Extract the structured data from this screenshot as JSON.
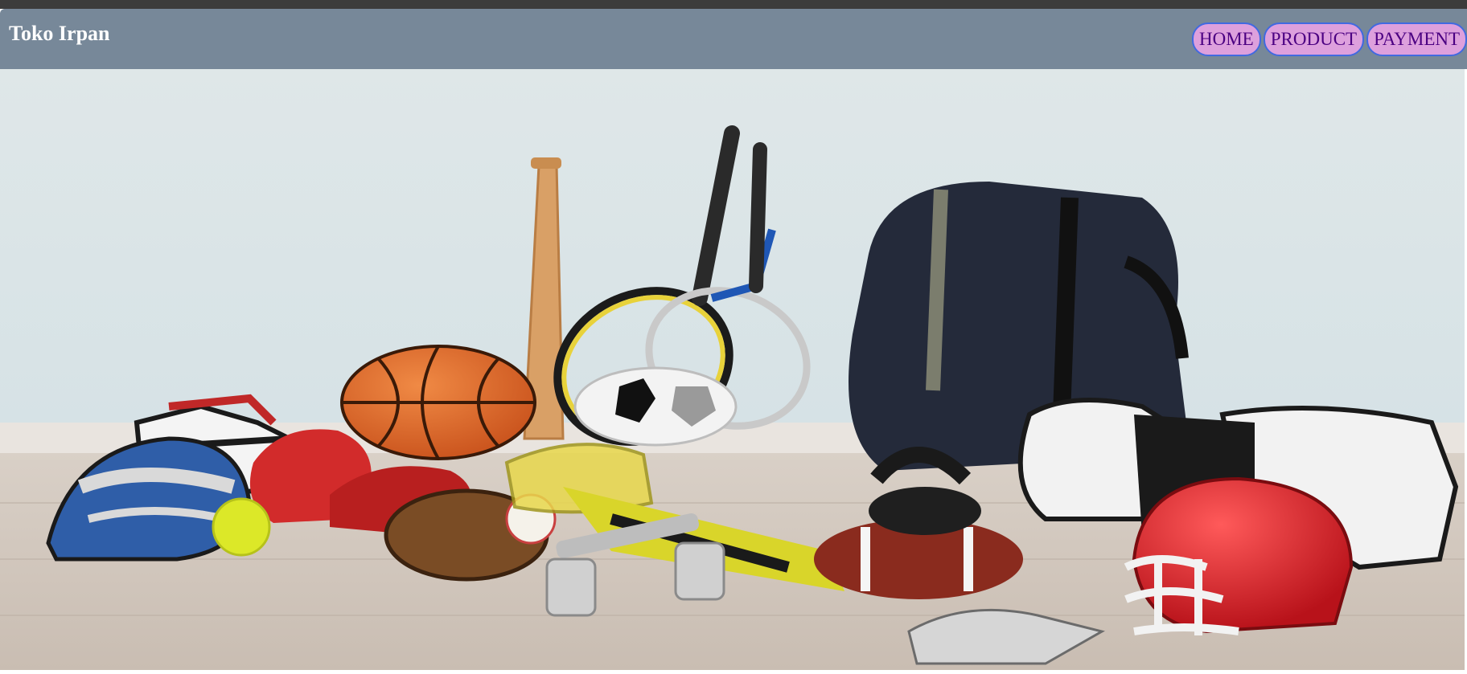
{
  "brand": {
    "name": "Toko Irpan"
  },
  "nav": {
    "items": [
      {
        "label": "HOME"
      },
      {
        "label": "PRODUCT"
      },
      {
        "label": "PAYMENT"
      }
    ]
  },
  "colors": {
    "navbar_bg": "#778899",
    "nav_button_bg": "#dda0dd",
    "nav_button_border": "#4169e1",
    "nav_button_text": "#4b0082",
    "brand_text": "#ffffff"
  },
  "hero": {
    "image_subject": "sports equipment"
  }
}
